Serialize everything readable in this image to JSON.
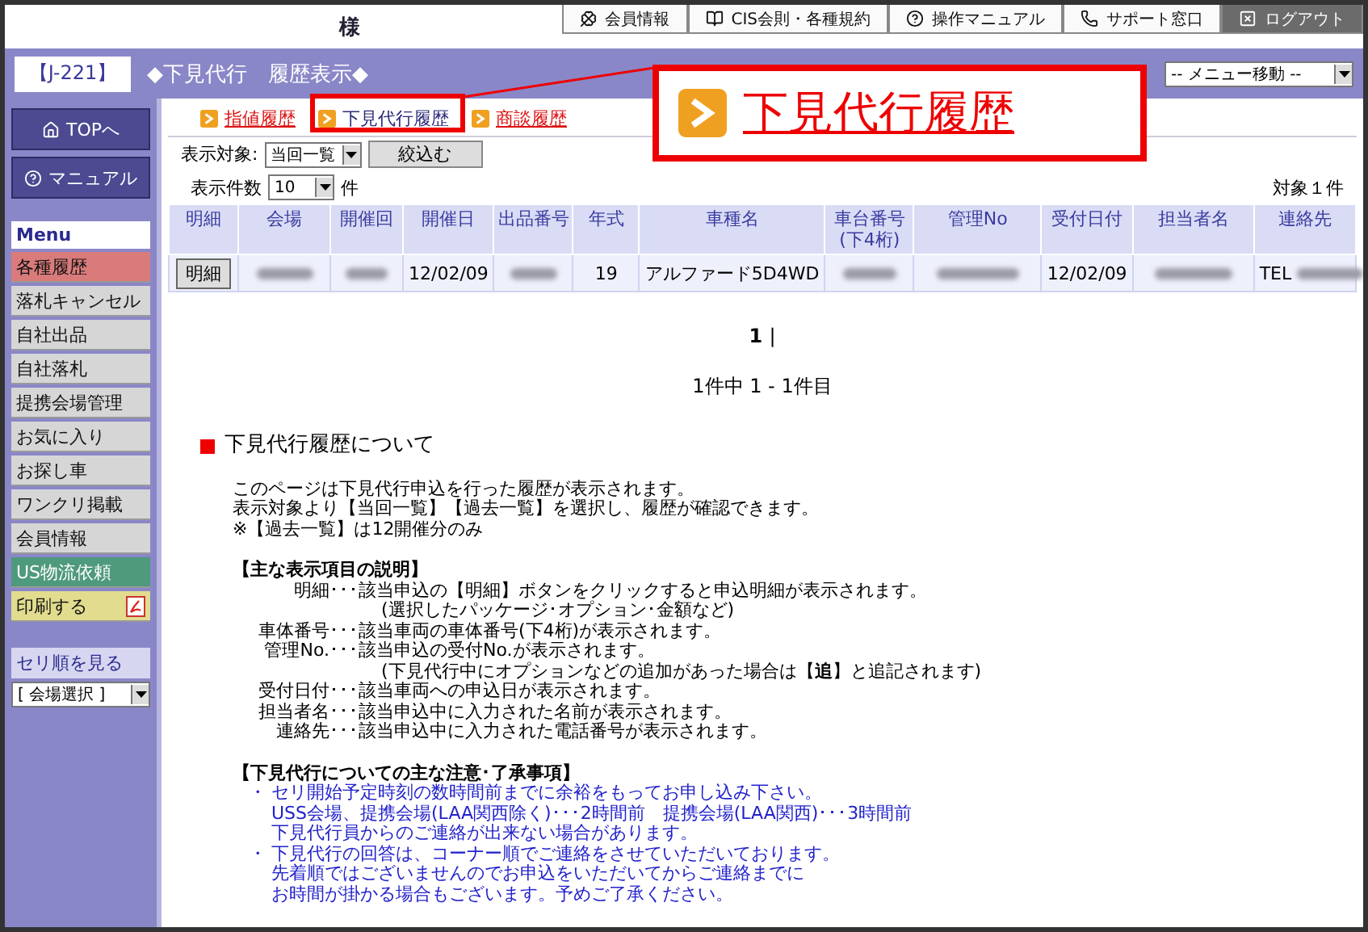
{
  "header": {
    "customer_suffix": "様",
    "nav": [
      {
        "kind": "club",
        "label": "会員情報"
      },
      {
        "kind": "book",
        "label": "CIS会則・各種規約"
      },
      {
        "kind": "help",
        "label": "操作マニュアル"
      },
      {
        "kind": "phone",
        "label": "サポート窓口"
      },
      {
        "kind": "logout",
        "label": "ログアウト"
      }
    ]
  },
  "subbar": {
    "code": "【J-221】",
    "title": "◆下見代行　履歴表示◆",
    "menu_select": "-- メニュー移動 --"
  },
  "sidebar": {
    "top_buttons": [
      {
        "kind": "home",
        "label": "TOPへ"
      },
      {
        "kind": "help",
        "label": "マニュアル"
      }
    ],
    "menu_title": "Menu",
    "items": [
      {
        "label": "各種履歴",
        "kind": "active"
      },
      {
        "label": "落札キャンセル",
        "kind": "normal"
      },
      {
        "label": "自社出品",
        "kind": "normal"
      },
      {
        "label": "自社落札",
        "kind": "normal"
      },
      {
        "label": "提携会場管理",
        "kind": "normal"
      },
      {
        "label": "お気に入り",
        "kind": "normal"
      },
      {
        "label": "お探し車",
        "kind": "normal"
      },
      {
        "label": "ワンクリ掲載",
        "kind": "normal"
      },
      {
        "label": "会員情報",
        "kind": "normal"
      },
      {
        "label": "US物流依頼",
        "kind": "green"
      },
      {
        "label": "印刷する",
        "kind": "print"
      }
    ],
    "seri_title": "セリ順を見る",
    "venue_select": "[ 会場選択 ]"
  },
  "tabs": [
    {
      "label": "指値履歴",
      "selected": false
    },
    {
      "label": "下見代行履歴",
      "selected": true
    },
    {
      "label": "商談履歴",
      "selected": false
    }
  ],
  "filter": {
    "label": "表示対象:",
    "select": "当回一覧",
    "button": "絞込む"
  },
  "count": {
    "label": "表示件数",
    "select": "10",
    "unit": "件"
  },
  "total": "対象１件",
  "table": {
    "columns": [
      {
        "label": "明細"
      },
      {
        "label": "会場"
      },
      {
        "label": "開催回"
      },
      {
        "label": "開催日"
      },
      {
        "label": "出品番号"
      },
      {
        "label": "年式"
      },
      {
        "label": "車種名"
      },
      {
        "label": "車台番号",
        "sublabel": "(下4桁)"
      },
      {
        "label": "管理No"
      },
      {
        "label": "受付日付"
      },
      {
        "label": "担当者名"
      },
      {
        "label": "連絡先"
      }
    ],
    "rows": [
      {
        "cells": [
          {
            "kind": "button",
            "text": "明細"
          },
          {
            "kind": "blurred"
          },
          {
            "kind": "blurred"
          },
          {
            "kind": "text",
            "text": "12/02/09"
          },
          {
            "kind": "blurred"
          },
          {
            "kind": "text",
            "text": "19"
          },
          {
            "kind": "text",
            "text": "アルファード5D4WD"
          },
          {
            "kind": "blurred"
          },
          {
            "kind": "blurred"
          },
          {
            "kind": "text",
            "text": "12/02/09"
          },
          {
            "kind": "blurred"
          },
          {
            "kind": "tel",
            "text": "TEL"
          }
        ]
      }
    ]
  },
  "pagination": {
    "page": "1",
    "separator": "|",
    "summary": "1件中 1 - 1件目"
  },
  "section": {
    "heading": "下見代行履歴について",
    "intro": [
      "このページは下見代行申込を行った履歴が表示されます。",
      "表示対象より【当回一覧】【過去一覧】を選択し、履歴が確認できます。",
      "※【過去一覧】は12開催分のみ"
    ],
    "explain_heading": "【主な表示項目の説明】",
    "explain": [
      {
        "kind": "item",
        "term": "明細･･･",
        "text": "該当申込の【明細】ボタンをクリックすると申込明細が表示されます。"
      },
      {
        "kind": "continuation",
        "text": "(選択したパッケージ･オプション･金額など)"
      },
      {
        "kind": "item",
        "term": "車体番号･･･",
        "text": "該当車両の車体番号(下4桁)が表示されます。"
      },
      {
        "kind": "item",
        "term": "管理No.･･･",
        "text": "該当申込の受付No.が表示されます。"
      },
      {
        "kind": "continuation",
        "text": "(下見代行中にオプションなどの追加があった場合は【**追**】と追記されます)"
      },
      {
        "kind": "item",
        "term": "受付日付･･･",
        "text": "該当車両への申込日が表示されます。"
      },
      {
        "kind": "item",
        "term": "担当者名･･･",
        "text": "該当申込中に入力された名前が表示されます。"
      },
      {
        "kind": "item",
        "term": "連絡先･･･",
        "text": "該当申込中に入力された電話番号が表示されます。"
      }
    ],
    "notes_heading": "【下見代行についての主な注意･了承事項】",
    "notes": [
      {
        "kind": "bullet",
        "bullet": "・",
        "text": "セリ開始予定時刻の数時間前までに余裕をもってお申し込み下さい。"
      },
      {
        "kind": "continuation",
        "text": "USS会場、提携会場(LAA関西除く)･･･2時間前　提携会場(LAA関西)･･･3時間前"
      },
      {
        "kind": "continuation",
        "text": "下見代行員からのご連絡が出来ない場合があります。"
      },
      {
        "kind": "bullet",
        "bullet": "・",
        "text": "下見代行の回答は、コーナー順でご連絡をさせていただいております。"
      },
      {
        "kind": "continuation",
        "text": "先着順ではございませんのでお申込をいただいてからご連絡までに"
      },
      {
        "kind": "continuation",
        "text": "お時間が掛かる場合もございます。予めご了承ください。"
      }
    ]
  },
  "callout": {
    "label": "下見代行履歴"
  }
}
